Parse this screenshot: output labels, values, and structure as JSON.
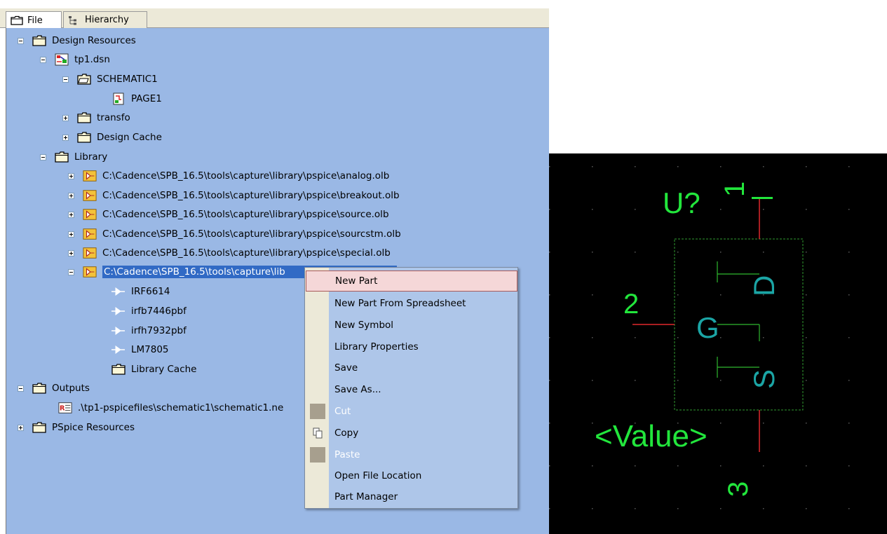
{
  "tabs": {
    "file": "File",
    "hierarchy": "Hierarchy"
  },
  "tree": {
    "design_resources": "Design Resources",
    "dsn_file": "tp1.dsn",
    "schematic": "SCHEMATIC1",
    "page": "PAGE1",
    "transfo": "transfo",
    "design_cache": "Design Cache",
    "library": "Library",
    "libraries": [
      "C:\\Cadence\\SPB_16.5\\tools\\capture\\library\\pspice\\analog.olb",
      "C:\\Cadence\\SPB_16.5\\tools\\capture\\library\\pspice\\breakout.olb",
      "C:\\Cadence\\SPB_16.5\\tools\\capture\\library\\pspice\\source.olb",
      "C:\\Cadence\\SPB_16.5\\tools\\capture\\library\\pspice\\sourcstm.olb",
      "C:\\Cadence\\SPB_16.5\\tools\\capture\\library\\pspice\\special.olb"
    ],
    "selected_library": "C:\\Cadence\\SPB_16.5\\tools\\capture\\lib",
    "parts": [
      "IRF6614",
      "irfb7446pbf",
      "irfh7932pbf",
      "LM7805"
    ],
    "library_cache": "Library Cache",
    "outputs": "Outputs",
    "netlist": ".\\tp1-pspicefiles\\schematic1\\schematic1.ne",
    "pspice_resources": "PSpice Resources"
  },
  "context_menu": {
    "items": [
      {
        "label": "New Part",
        "state": "highlighted"
      },
      {
        "label": "New Part From Spreadsheet",
        "state": "enabled"
      },
      {
        "label": "New Symbol",
        "state": "enabled"
      },
      {
        "label": "Library Properties",
        "state": "enabled"
      },
      {
        "label": "Save",
        "state": "enabled"
      },
      {
        "label": "Save As...",
        "state": "enabled"
      },
      {
        "label": "Cut",
        "state": "disabled"
      },
      {
        "label": "Copy",
        "state": "enabled",
        "icon": "copy-icon"
      },
      {
        "label": "Paste",
        "state": "disabled"
      },
      {
        "label": "Open File Location",
        "state": "enabled"
      },
      {
        "label": "Part Manager",
        "state": "enabled"
      }
    ]
  },
  "symbol": {
    "ref": "U?",
    "value": "<Value>",
    "pin1": "1",
    "pin2": "2",
    "pin3": "3",
    "drain": "D",
    "gate": "G",
    "source": "S"
  },
  "colors": {
    "tree_bg": "#9ab8e5",
    "selection": "#316ac5",
    "menu_bg": "#aec6e9",
    "menu_highlight": "#f5d7d8",
    "canvas_bg": "#000000",
    "pin_text": "#22e63c",
    "pin_name_text": "#1ba5a5",
    "pin_line": "#e0282c",
    "body_outline": "#2f9a2f"
  }
}
